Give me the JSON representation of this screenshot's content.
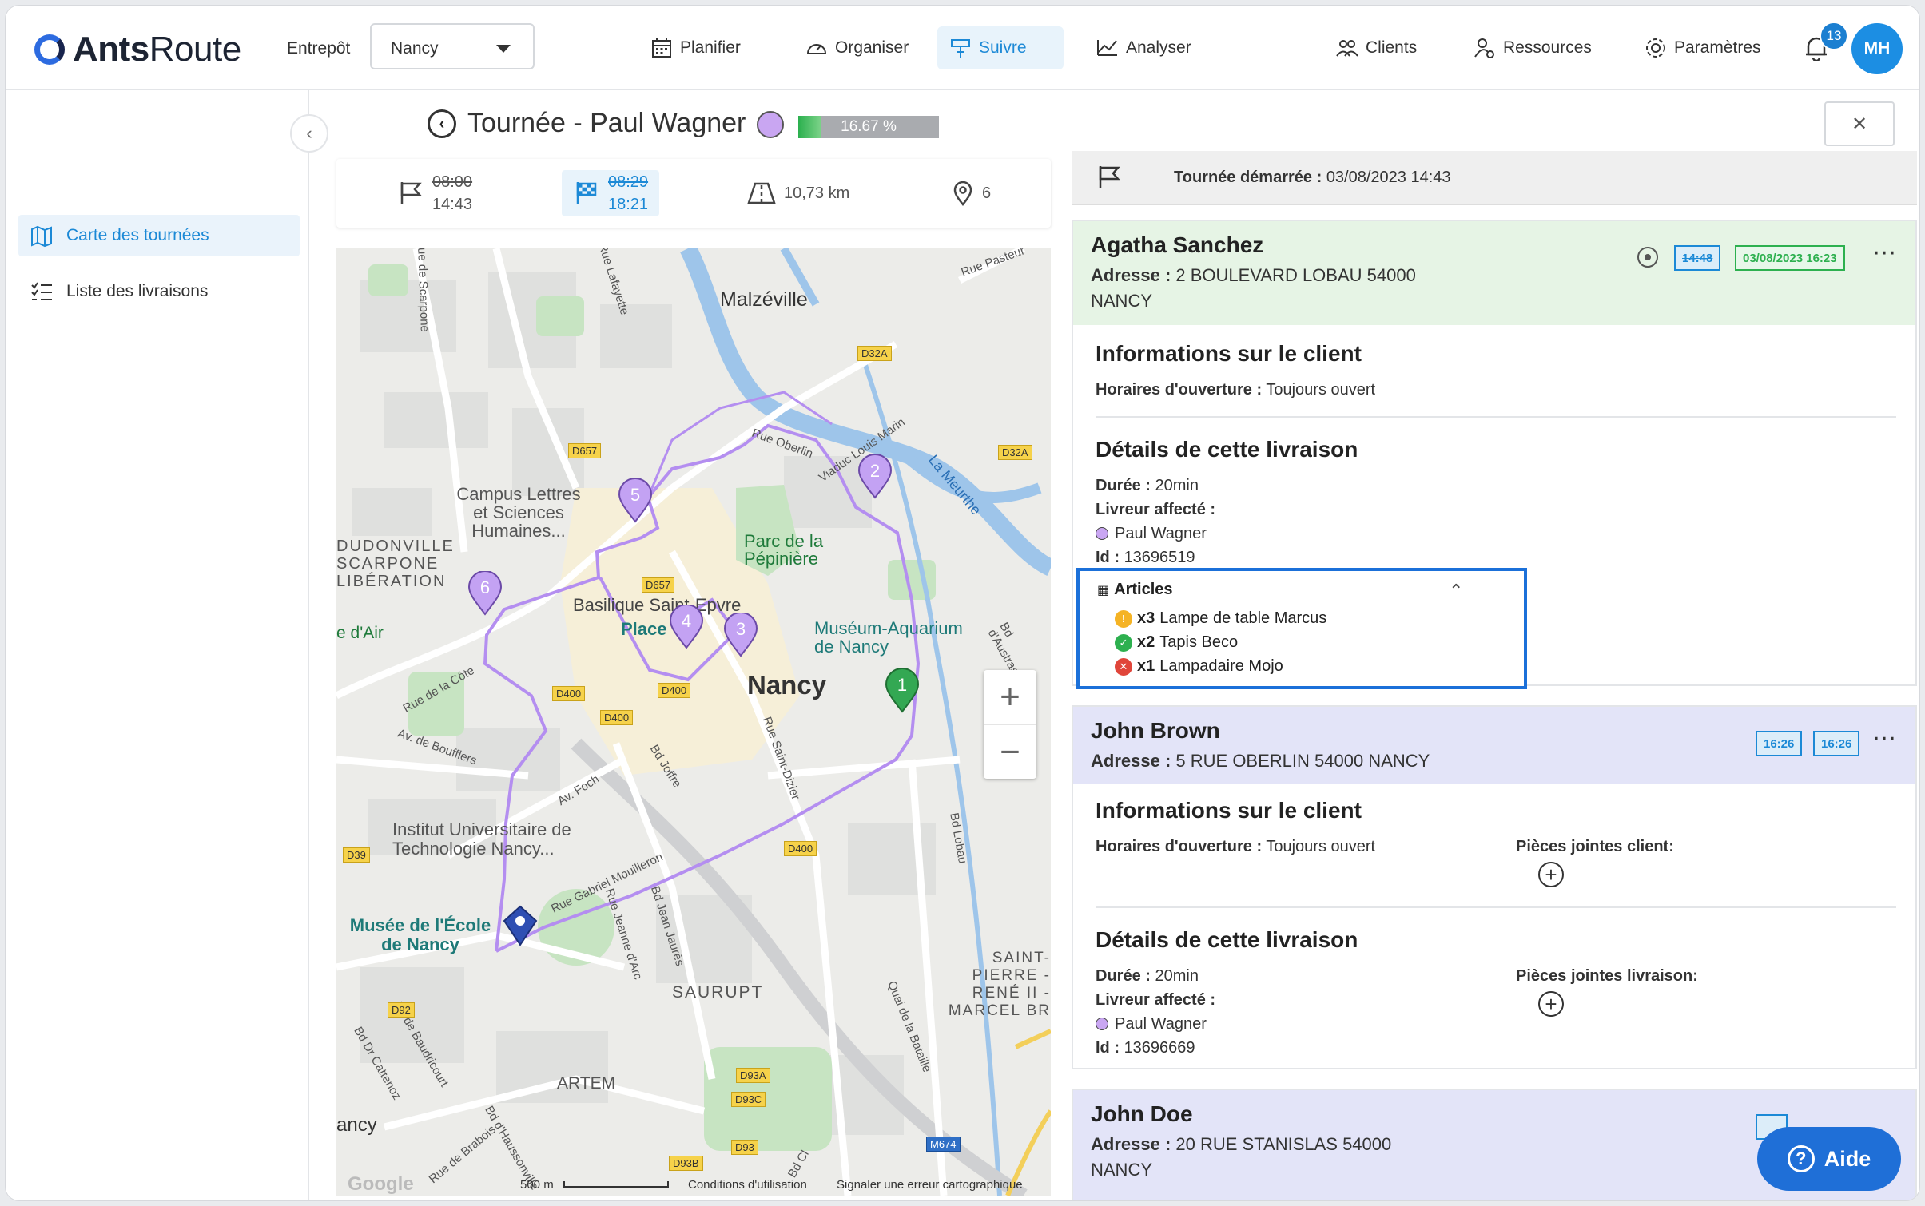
{
  "app": {
    "logo_bold": "Ants",
    "logo_light": "Route"
  },
  "header": {
    "warehouse_label": "Entrepôt",
    "warehouse_value": "Nancy",
    "nav": [
      "Planifier",
      "Organiser",
      "Suivre",
      "Analyser",
      "Clients",
      "Ressources",
      "Paramètres"
    ],
    "notifications": "13",
    "user_initials": "MH"
  },
  "sidebar": {
    "items": [
      "Carte des tournées",
      "Liste des livraisons"
    ]
  },
  "tour": {
    "title": "Tournée - Paul Wagner",
    "progress_label": "16.67 %",
    "progress": 0.1667
  },
  "stats": {
    "start_planned": "08:00",
    "start_actual": "14:43",
    "end_planned": "08:29",
    "end_actual": "18:21",
    "distance": "10,73 km",
    "stops": "6"
  },
  "map": {
    "places": [
      "Malzéville",
      "Nancy",
      "Parc de la Pépinière",
      "Campus Lettres et Sciences Humaines...",
      "Basilique Saint-Epvre",
      "Place",
      "Muséum-Aquarium de Nancy",
      "Institut Universitaire de Technologie Nancy...",
      "Musée de l'École de Nancy",
      "SAURUPT",
      "ARTEM",
      "SAINT-PIERRE - RENÉ II - MARCEL BR",
      "DUDONVILLE SCARPONE LIBÉRATION",
      "e d'Air",
      "ancy"
    ],
    "roads": [
      "Rue Lafayette",
      "Rue Pasteur",
      "Rue Oberlin",
      "Viaduc Louis Marin",
      "La Meurthe",
      "Rue de la Côte",
      "Av. de Boufflers",
      "Av. Foch",
      "Bd Joffre",
      "Rue Saint-Dizier",
      "Rue Gabriel Mouilleron",
      "Rue Jeanne d'Arc",
      "Bd Jean Jaurès",
      "Bd Lobau",
      "Quai de la Bataille",
      "Bd d'Austrasie",
      "Bd de Baudricourt",
      "Bd Dr Cattenoz",
      "Rue de Scarpone",
      "Bd d'Haussonville",
      "Bd Cl",
      "Rue de Brabois"
    ],
    "shields": [
      "D32A",
      "D32A",
      "D657",
      "D657",
      "D400",
      "D400",
      "D400",
      "D400",
      "D39",
      "D92",
      "D93A",
      "D93C",
      "D93",
      "D93B",
      "M674"
    ],
    "stops": [
      "1",
      "2",
      "3",
      "4",
      "5",
      "6"
    ],
    "footer": [
      "Google",
      "500 m",
      "Conditions d'utilisation",
      "Signaler une erreur cartographique"
    ]
  },
  "panel": {
    "started_label": "Tournée démarrée :",
    "started_value": "03/08/2023 14:43",
    "client_info_title": "Informations sur le client",
    "delivery_title": "Détails de cette livraison",
    "hours_label": "Horaires d'ouverture :",
    "duration_label": "Durée :",
    "driver_label": "Livreur affecté :",
    "id_label": "Id :",
    "address_label": "Adresse :",
    "client_attachments": "Pièces jointes client:",
    "delivery_attachments": "Pièces jointes livraison:",
    "articles_title": "Articles",
    "help": "Aide"
  },
  "deliveries": [
    {
      "name": "Agatha Sanchez",
      "address_line1": "2 BOULEVARD LOBAU 54000",
      "address_line2": "NANCY",
      "eta": "14:48",
      "done": "03/08/2023 16:23",
      "hours": "Toujours ouvert",
      "duration": "20min",
      "driver": "Paul Wagner",
      "id": "13696519",
      "articles": [
        {
          "qty": "x3",
          "name": "Lampe de table Marcus",
          "status": "warning",
          "color": "#f5b324"
        },
        {
          "qty": "x2",
          "name": "Tapis Beco",
          "status": "ok",
          "color": "#2db04f"
        },
        {
          "qty": "x1",
          "name": "Lampadaire Mojo",
          "status": "error",
          "color": "#e0453a"
        }
      ]
    },
    {
      "name": "John Brown",
      "address_line1": "5 RUE OBERLIN 54000 NANCY",
      "eta_planned": "16:26",
      "eta": "16:26",
      "hours": "Toujours ouvert",
      "duration": "20min",
      "driver": "Paul Wagner",
      "id": "13696669"
    },
    {
      "name": "John Doe",
      "address_line1": "20 RUE STANISLAS 54000",
      "address_line2": "NANCY"
    }
  ],
  "colors": {
    "accent": "#1c89d6",
    "route": "#b48ef0",
    "started_bg": "#efefef",
    "done_bg": "#e6f4e5",
    "planned_bg": "#e3e4f8"
  }
}
